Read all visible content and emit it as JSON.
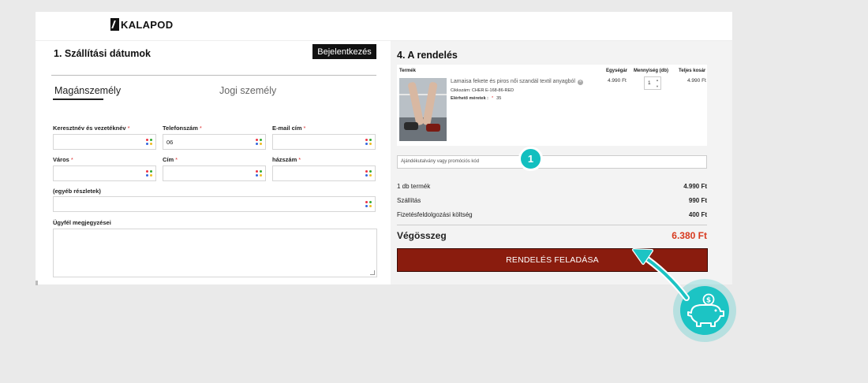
{
  "brand": {
    "logo_text": "KALAPOD"
  },
  "shipping": {
    "title": "1. Szállítási dátumok",
    "login_label": "Bejelentkezés",
    "tabs": [
      {
        "label": "Magánszemély",
        "active": true
      },
      {
        "label": "Jogi személy",
        "active": false
      }
    ],
    "fields": {
      "name_label": "Keresztnév és vezetéknév",
      "phone_label": "Telefonszám",
      "phone_value": "06",
      "email_label": "E-mail cím",
      "city_label": "Város",
      "address_label": "Cím",
      "house_label": "házszám",
      "other_label": "(egyéb részletek)",
      "notes_label": "Ügyfél megjegyzései",
      "required_mark": "*"
    }
  },
  "order": {
    "title": "4. A rendelés",
    "headers": {
      "product": "Termék",
      "unit_price": "Egységár",
      "quantity": "Mennyiség (db)",
      "total": "Teljes kosár"
    },
    "item": {
      "name": "Lamaisa fekete és piros női szandál textil anyagból",
      "remove_glyph": "×",
      "sku_label": "Cikkszám:",
      "sku": "CHER E-168-86-RED",
      "size_label": "Elérhető méretek :",
      "size": "35",
      "unit_price": "4.990 Ft",
      "quantity": "1",
      "total": "4.990 Ft"
    },
    "promo_placeholder": "Ajándékutalvány vagy promóciós kód",
    "summary": [
      {
        "label": "1 db termék",
        "value": "4.990 Ft"
      },
      {
        "label": "Szállítás",
        "value": "990 Ft"
      },
      {
        "label": "Fizetésfeldolgozási költség",
        "value": "400 Ft"
      }
    ],
    "grand_total_label": "Végösszeg",
    "grand_total_value": "6.380 Ft",
    "submit_label": "RENDELÉS FELADÁSA"
  },
  "annotation": {
    "step_number": "1"
  },
  "colors": {
    "accent_teal": "#1cc4c4",
    "submit_button": "#8a1c0e",
    "total_red": "#d7391e"
  }
}
